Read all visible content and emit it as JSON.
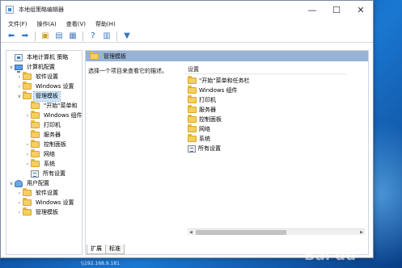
{
  "window": {
    "title": "本地组策略编辑器",
    "controls": {
      "minimize": "—",
      "maximize": "☐",
      "close": "✕"
    }
  },
  "menu": [
    {
      "label": "文件(F)"
    },
    {
      "label": "操作(A)"
    },
    {
      "label": "查看(V)"
    },
    {
      "label": "帮助(H)"
    }
  ],
  "toolbar": {
    "buttons": [
      {
        "name": "back-button",
        "glyph": "⬅",
        "color": "#2a74c9"
      },
      {
        "name": "forward-button",
        "glyph": "➡",
        "color": "#2a74c9"
      },
      {
        "name": "up-folder-button",
        "glyph": "▣",
        "color": "#c9a227"
      },
      {
        "name": "show-hide-tree-button",
        "glyph": "▤",
        "color": "#4a7fbd"
      },
      {
        "name": "export-list-button",
        "glyph": "▦",
        "color": "#4a7fbd"
      },
      {
        "name": "help-button",
        "glyph": "?",
        "color": "#1f5fae"
      },
      {
        "name": "properties-button",
        "glyph": "▥",
        "color": "#4a7fbd"
      },
      {
        "name": "filter-button",
        "glyph": "▼",
        "color": "#3c78c0"
      }
    ]
  },
  "tree": {
    "items": [
      {
        "label": "本地计算机 策略",
        "icon": "policy-icon",
        "arrow": "",
        "selected": false
      },
      {
        "label": "计算机配置",
        "icon": "computer-icon",
        "arrow": "∨",
        "selected": false
      },
      {
        "label": "软件设置",
        "icon": "folder-icon",
        "arrow": "›",
        "selected": false
      },
      {
        "label": "Windows 设置",
        "icon": "folder-icon",
        "arrow": "›",
        "selected": false
      },
      {
        "label": "管理模板",
        "icon": "folder-icon",
        "arrow": "∨",
        "selected": true
      },
      {
        "label": "\"开始\"菜单和",
        "icon": "folder-icon",
        "arrow": "",
        "selected": false
      },
      {
        "label": "Windows 组件",
        "icon": "folder-icon",
        "arrow": "›",
        "selected": false
      },
      {
        "label": "打印机",
        "icon": "folder-icon",
        "arrow": "",
        "selected": false
      },
      {
        "label": "服务器",
        "icon": "folder-icon",
        "arrow": "",
        "selected": false
      },
      {
        "label": "控制面板",
        "icon": "folder-icon",
        "arrow": "›",
        "selected": false
      },
      {
        "label": "网络",
        "icon": "folder-icon",
        "arrow": "›",
        "selected": false
      },
      {
        "label": "系统",
        "icon": "folder-icon",
        "arrow": "›",
        "selected": false
      },
      {
        "label": "所有设置",
        "icon": "settings-icon",
        "arrow": "",
        "selected": false
      },
      {
        "label": "用户配置",
        "icon": "user-icon",
        "arrow": "∨",
        "selected": false
      },
      {
        "label": "软件设置",
        "icon": "folder-icon",
        "arrow": "›",
        "selected": false
      },
      {
        "label": "Windows 设置",
        "icon": "folder-icon",
        "arrow": "›",
        "selected": false
      },
      {
        "label": "管理模板",
        "icon": "folder-icon",
        "arrow": "›",
        "selected": false
      }
    ]
  },
  "right": {
    "header": "管理模板",
    "description": "选择一个项目来查看它的描述。",
    "list_header": "设置",
    "items": [
      {
        "label": "\"开始\"菜单和任务栏",
        "icon": "folder-icon"
      },
      {
        "label": "Windows 组件",
        "icon": "folder-icon"
      },
      {
        "label": "打印机",
        "icon": "folder-icon"
      },
      {
        "label": "服务器",
        "icon": "folder-icon"
      },
      {
        "label": "控制面板",
        "icon": "folder-icon"
      },
      {
        "label": "网络",
        "icon": "folder-icon"
      },
      {
        "label": "系统",
        "icon": "folder-icon"
      },
      {
        "label": "所有设置",
        "icon": "settings-icon"
      }
    ],
    "tabs": [
      {
        "label": "扩展",
        "active": true
      },
      {
        "label": "标准",
        "active": false
      }
    ]
  },
  "desktop": {
    "status_text": "\\\\192.168.9.181",
    "watermark": "Bai du"
  }
}
